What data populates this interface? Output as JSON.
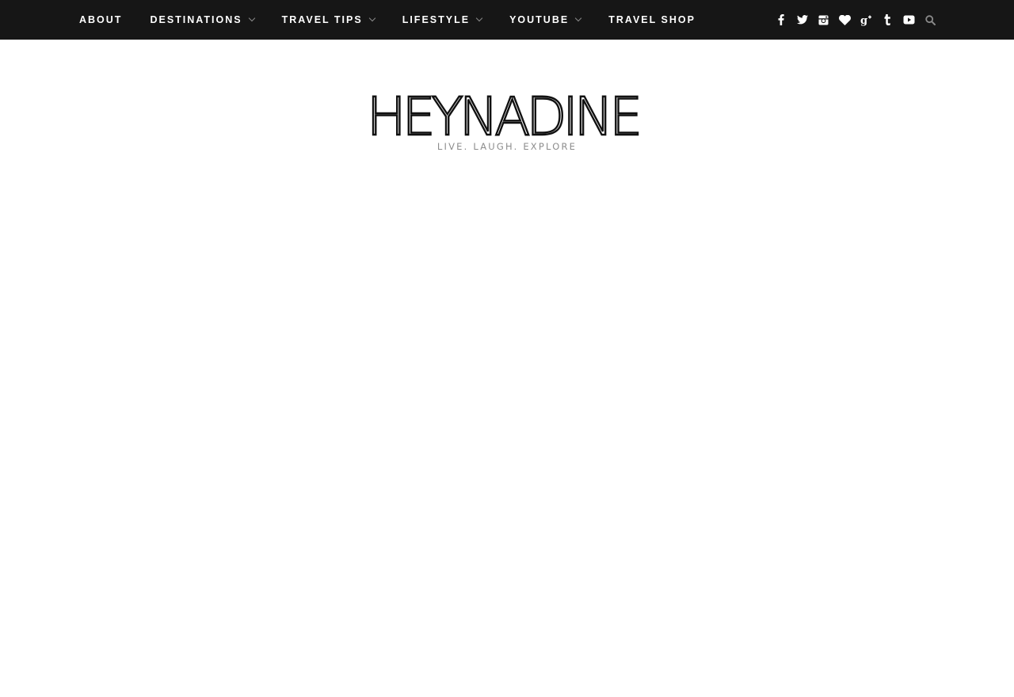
{
  "nav": {
    "items": [
      {
        "label": "ABOUT",
        "has_dropdown": false
      },
      {
        "label": "DESTINATIONS",
        "has_dropdown": true
      },
      {
        "label": "TRAVEL TIPS",
        "has_dropdown": true
      },
      {
        "label": "LIFESTYLE",
        "has_dropdown": true
      },
      {
        "label": "YOUTUBE",
        "has_dropdown": true
      },
      {
        "label": "TRAVEL SHOP",
        "has_dropdown": false
      }
    ]
  },
  "social": {
    "icons": [
      "facebook-icon",
      "twitter-icon",
      "instagram-icon",
      "bloglovin-heart-icon",
      "google-plus-icon",
      "tumblr-icon",
      "youtube-icon"
    ],
    "icon_color": "#ffffff"
  },
  "search": {
    "icon": "search-icon",
    "color": "#8a8a8a"
  },
  "header": {
    "logo_text": "HEYNADINE",
    "tagline": "LIVE. LAUGH. EXPLORE"
  },
  "colors": {
    "topbar_bg": "#161616",
    "nav_text": "#ffffff",
    "tagline": "#8d8d8d",
    "page_bg": "#ffffff"
  }
}
